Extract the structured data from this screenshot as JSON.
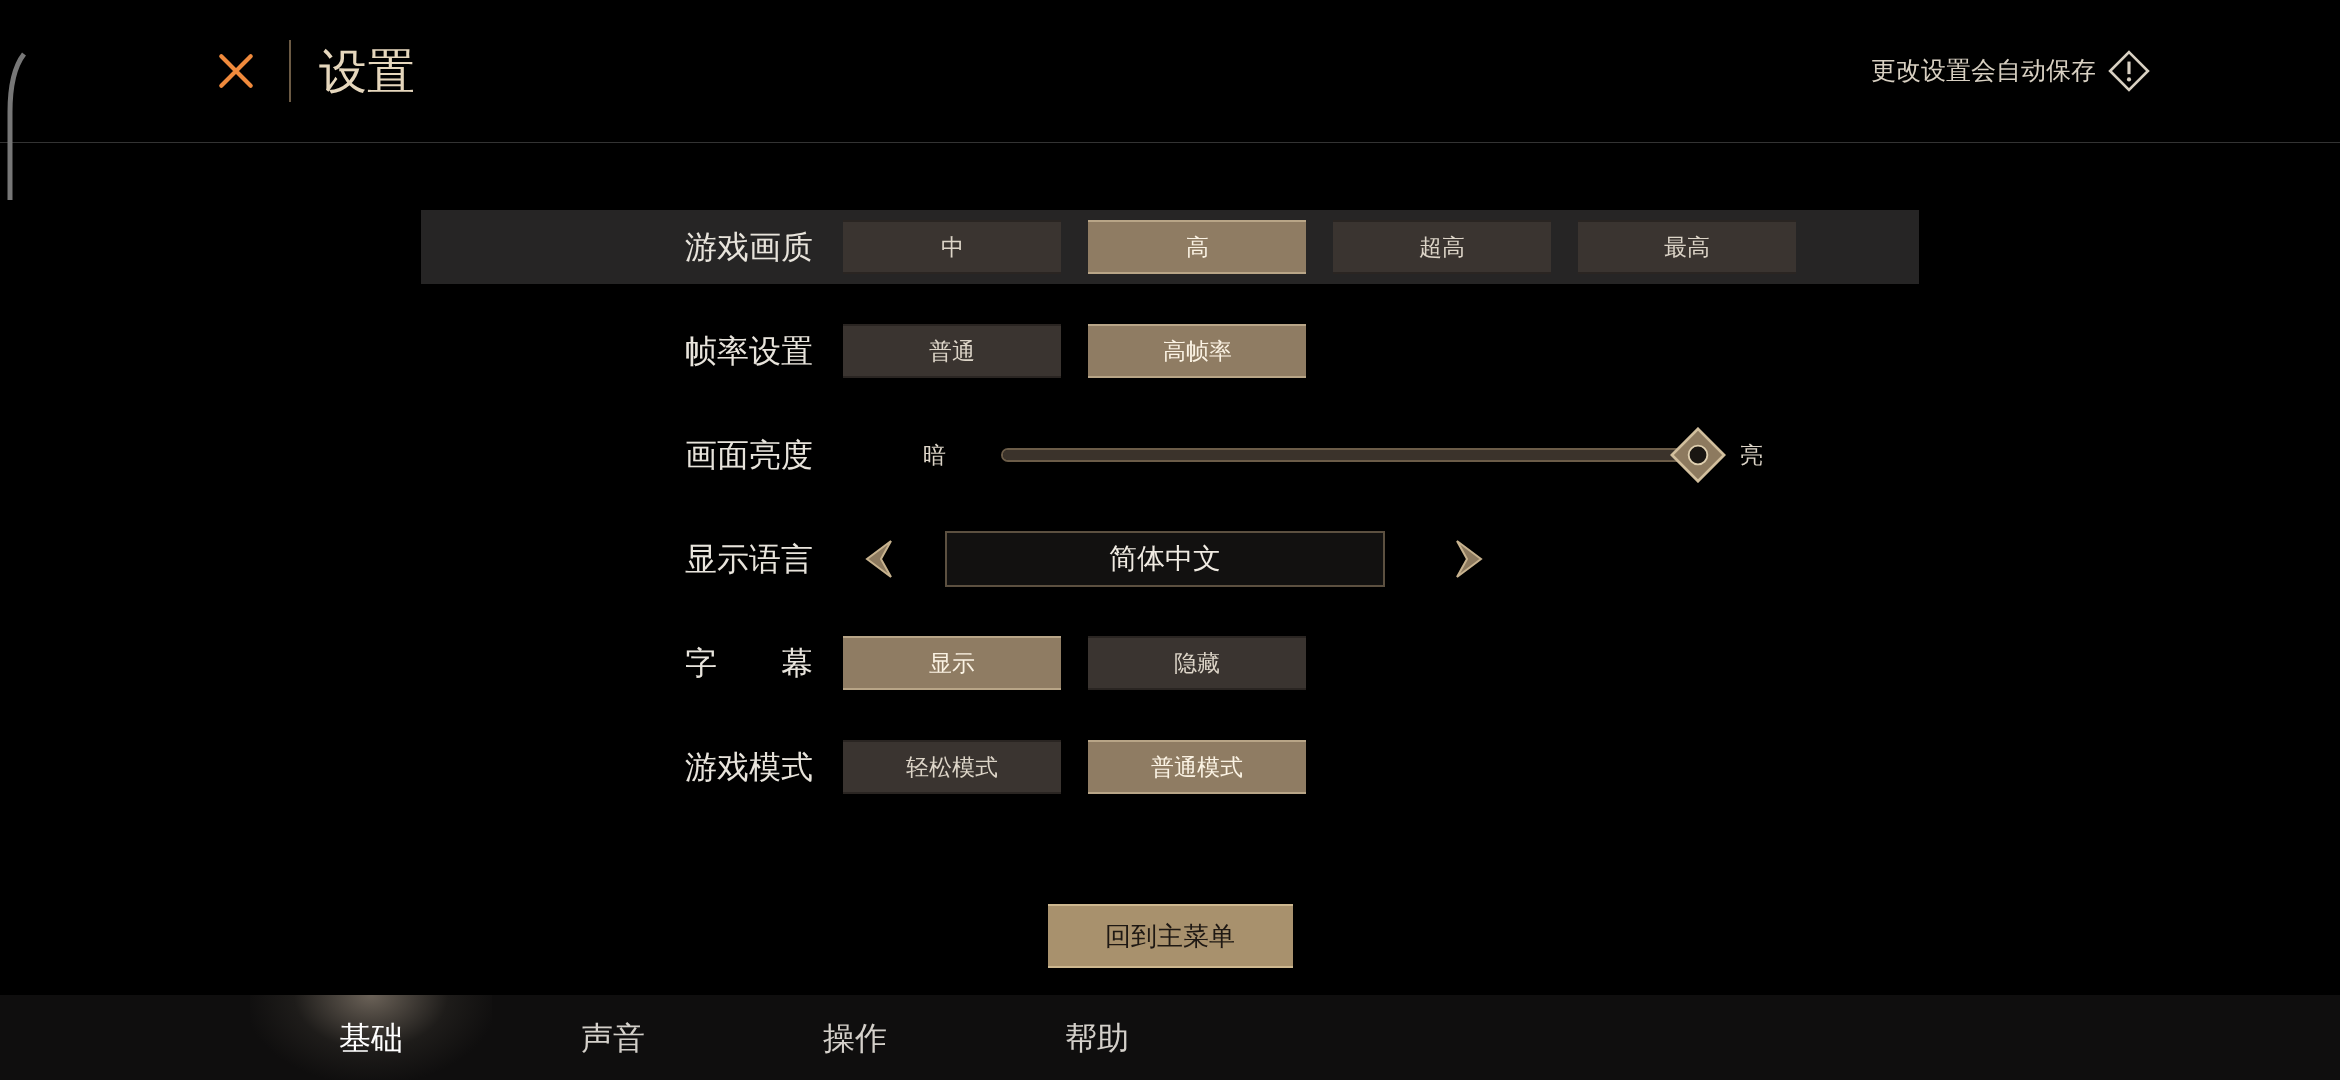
{
  "header": {
    "title": "设置",
    "autosave_note": "更改设置会自动保存"
  },
  "settings": [
    {
      "kind": "options",
      "label": "游戏画质",
      "highlighted": true,
      "options": [
        {
          "label": "中",
          "selected": false
        },
        {
          "label": "高",
          "selected": true
        },
        {
          "label": "超高",
          "selected": false
        },
        {
          "label": "最高",
          "selected": false
        }
      ]
    },
    {
      "kind": "options",
      "label": "帧率设置",
      "highlighted": false,
      "options": [
        {
          "label": "普通",
          "selected": false
        },
        {
          "label": "高帧率",
          "selected": true
        }
      ]
    },
    {
      "kind": "slider",
      "label": "画面亮度",
      "highlighted": false,
      "min_label": "暗",
      "max_label": "亮",
      "level": 1.0
    },
    {
      "kind": "selector",
      "label": "显示语言",
      "highlighted": false,
      "value": "简体中文"
    },
    {
      "kind": "options",
      "label": "字　　幕",
      "highlighted": false,
      "options": [
        {
          "label": "显示",
          "selected": true
        },
        {
          "label": "隐藏",
          "selected": false
        }
      ]
    },
    {
      "kind": "options",
      "label": "游戏模式",
      "highlighted": false,
      "options": [
        {
          "label": "轻松模式",
          "selected": false
        },
        {
          "label": "普通模式",
          "selected": true
        }
      ]
    }
  ],
  "main_menu_button": "回到主菜单",
  "tabs": [
    {
      "label": "基础",
      "selected": true
    },
    {
      "label": "声音",
      "selected": false
    },
    {
      "label": "操作",
      "selected": false
    },
    {
      "label": "帮助",
      "selected": false
    }
  ]
}
